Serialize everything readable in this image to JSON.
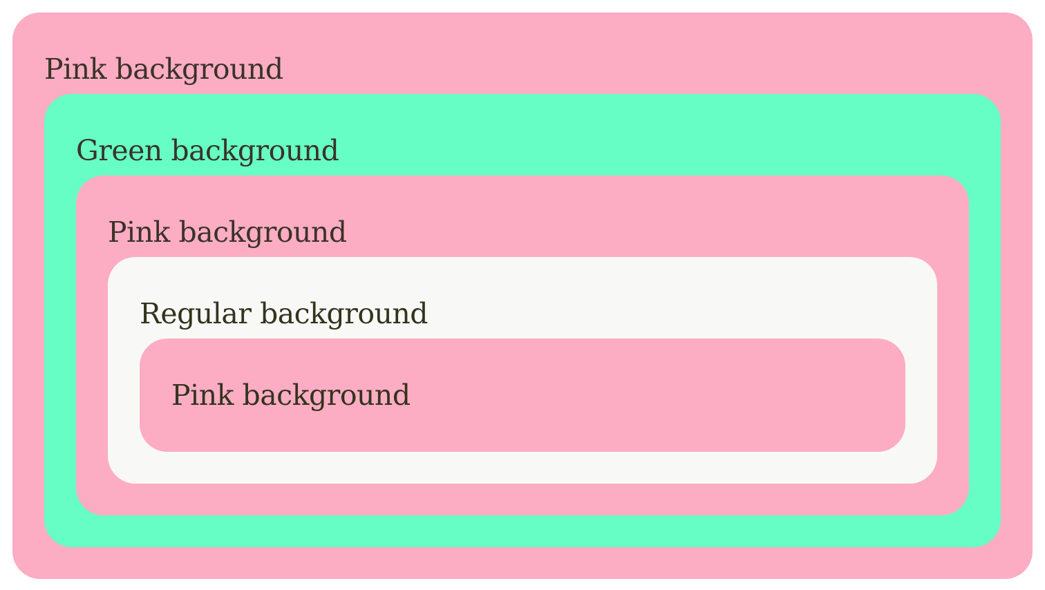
{
  "colors": {
    "pink": "#fcadc3",
    "green": "#66fec4",
    "regular": "#f8f9f6",
    "text": "#3a3328"
  },
  "boxes": [
    {
      "label": "Pink background"
    },
    {
      "label": "Green background"
    },
    {
      "label": "Pink background"
    },
    {
      "label": "Regular background"
    },
    {
      "label": "Pink background"
    }
  ]
}
